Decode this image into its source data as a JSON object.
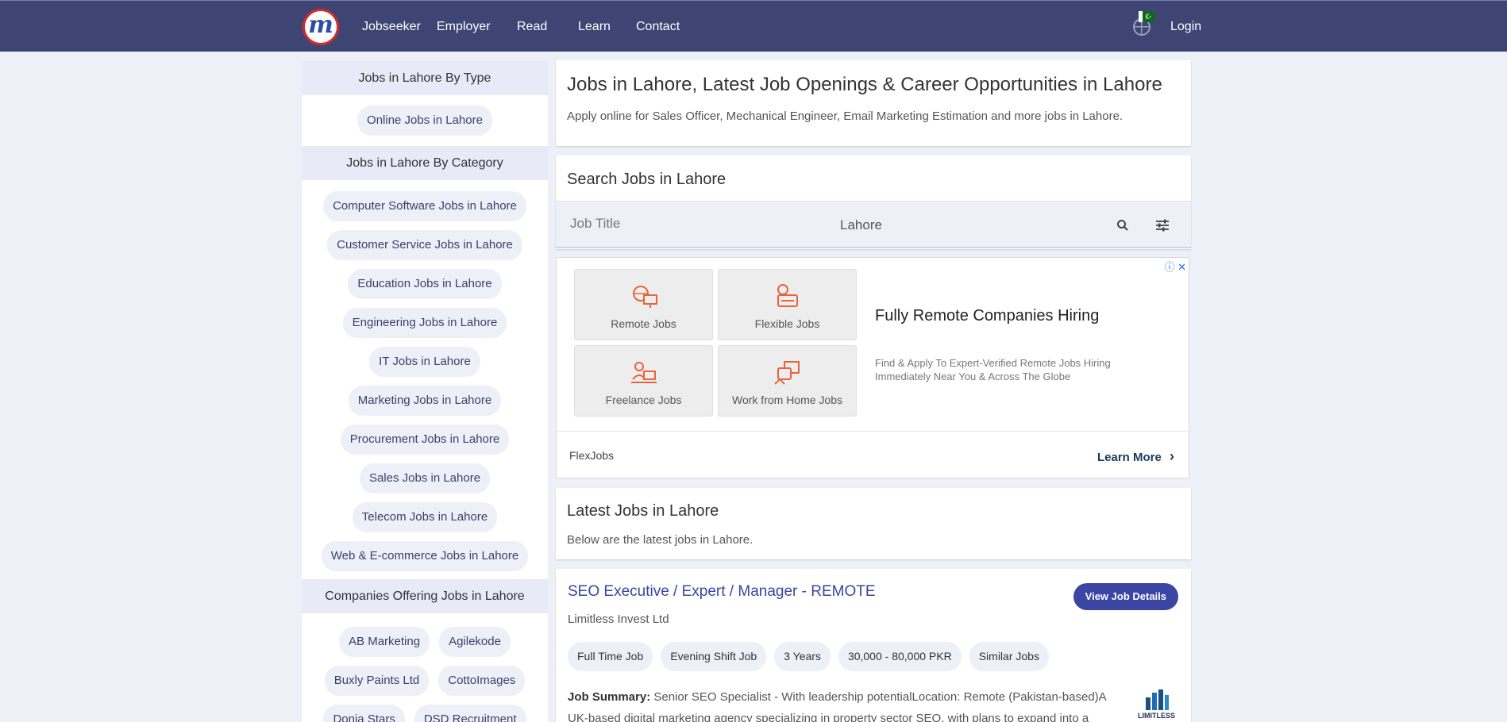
{
  "nav": {
    "logo_letter": "m",
    "links": [
      "Jobseeker",
      "Employer",
      "Read",
      "Learn",
      "Contact"
    ],
    "login": "Login",
    "flag_glyph": "☪"
  },
  "sidebar": {
    "by_type_heading": "Jobs in Lahore By Type",
    "by_type": [
      "Online Jobs in Lahore"
    ],
    "by_category_heading": "Jobs in Lahore By Category",
    "by_category": [
      "Computer Software Jobs in Lahore",
      "Customer Service Jobs in Lahore",
      "Education Jobs in Lahore",
      "Engineering Jobs in Lahore",
      "IT Jobs in Lahore",
      "Marketing Jobs in Lahore",
      "Procurement Jobs in Lahore",
      "Sales Jobs in Lahore",
      "Telecom Jobs in Lahore",
      "Web & E-commerce Jobs in Lahore"
    ],
    "companies_heading": "Companies Offering Jobs in Lahore",
    "companies": [
      "AB Marketing",
      "Agilekode",
      "Buxly Paints Ltd",
      "CottoImages",
      "Donia Stars",
      "DSD Recruitment"
    ]
  },
  "header_card": {
    "title": "Jobs in Lahore, Latest Job Openings & Career Opportunities in Lahore",
    "subtitle": "Apply online for Sales Officer, Mechanical Engineer, Email Marketing Estimation and more jobs in Lahore."
  },
  "search": {
    "heading": "Search Jobs in Lahore",
    "placeholder": "Job Title",
    "location": "Lahore"
  },
  "ad": {
    "tiles": [
      "Remote Jobs",
      "Flexible Jobs",
      "Freelance Jobs",
      "Work from Home Jobs"
    ],
    "title": "Fully Remote Companies Hiring",
    "description": "Find & Apply To Expert-Verified Remote Jobs Hiring Immediately Near You & Across The Globe",
    "brand": "FlexJobs",
    "cta": "Learn More",
    "cta_arrow": "›",
    "info_close": "ⓘ ✕"
  },
  "latest": {
    "heading": "Latest Jobs in Lahore",
    "subtitle": "Below are the latest jobs in Lahore."
  },
  "job": {
    "title": "SEO Executive / Expert / Manager - REMOTE",
    "company": "Limitless Invest Ltd",
    "button": "View Job Details",
    "tags": [
      "Full Time Job",
      "Evening Shift Job",
      "3 Years",
      "30,000 - 80,000 PKR",
      "Similar Jobs"
    ],
    "summary_label": "Job Summary:",
    "summary_text": " Senior SEO Specialist - With leadership potentialLocation: Remote (Pakistan-based)A UK-based digital marketing agency specializing in property sector SEO, with plans to expand into a",
    "logo_text": "LIMITLESS"
  }
}
